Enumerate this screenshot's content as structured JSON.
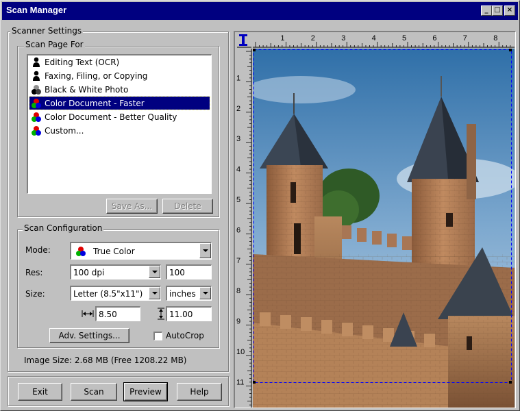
{
  "window": {
    "title": "Scan Manager",
    "minimize_glyph": "_",
    "maximize_glyph": "□",
    "close_glyph": "×"
  },
  "scanner_settings": {
    "group_label": "Scanner Settings",
    "scan_page_for": {
      "group_label": "Scan Page For",
      "items": [
        {
          "label": "Editing Text (OCR)",
          "icon": "person-icon"
        },
        {
          "label": "Faxing, Filing, or Copying",
          "icon": "person-icon"
        },
        {
          "label": "Black & White Photo",
          "icon": "grayscale-circles-icon"
        },
        {
          "label": "Color Document - Faster",
          "icon": "rgb-circles-icon",
          "selected": true
        },
        {
          "label": "Color Document - Better Quality",
          "icon": "rgb-circles-icon"
        },
        {
          "label": "Custom...",
          "icon": "rgb-circles-icon"
        }
      ],
      "save_as_label": "Save As...",
      "delete_label": "Delete"
    },
    "scan_configuration": {
      "group_label": "Scan Configuration",
      "mode_label": "Mode:",
      "mode_value": "True Color",
      "res_label": "Res:",
      "res_value": "100 dpi",
      "res_custom": "100",
      "size_label": "Size:",
      "size_value": "Letter (8.5\"x11\")",
      "units_value": "inches",
      "width_value": "8.50",
      "height_value": "11.00",
      "adv_settings_label": "Adv. Settings...",
      "autocrop_label": "AutoCrop",
      "autocrop_checked": false
    },
    "image_size": "Image Size: 2.68 MB (Free 1208.22 MB)"
  },
  "buttons": {
    "exit": "Exit",
    "scan": "Scan",
    "preview": "Preview",
    "help": "Help"
  },
  "preview": {
    "ruler_h": [
      "1",
      "2",
      "3",
      "4",
      "5",
      "6",
      "7",
      "8"
    ],
    "ruler_v": [
      "1",
      "2",
      "3",
      "4",
      "5",
      "6",
      "7",
      "8",
      "9",
      "10",
      "11"
    ],
    "ruler_corner_icon": "text-cursor-icon",
    "image_subject": "castle-photo"
  },
  "colors": {
    "titlebar": "#000080",
    "face": "#c0c0c0",
    "selection": "#000080",
    "crop_border": "#0000ff"
  }
}
